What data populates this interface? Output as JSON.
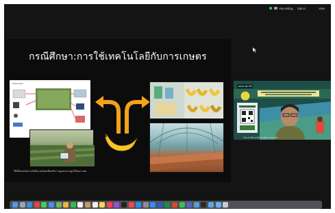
{
  "menubar": {
    "recording_label": "Recording...",
    "stop_label": "Stat in",
    "view_label": "View"
  },
  "slide": {
    "title": "กรณีศึกษา:การใช้เทคโนโลยีกับการเกษตร",
    "diagram_heading": "Smart Farm",
    "caption": "ใช้เซ็นเซอร์ตรวจวัดสิ่งแวดล้อมเพื่อปรับการดูแลเพาะปลูกให้เหมาะสม"
  },
  "video": {
    "presenter_name": "ผศ.ดร.สุภาวดี",
    "banner_text": "มหาวิทยาลัยราชภัฏ",
    "caption": "โครงการพัฒนาศักยภาพด้านการเกษตร"
  },
  "colors": {
    "arrow": "#f2a21b",
    "banana": "#f6c626",
    "video_bg": "#1f4d48",
    "recording_dot": "#3ec45a"
  },
  "dock": {
    "icons": [
      {
        "name": "finder-icon",
        "color": "#4a9be8"
      },
      {
        "name": "launchpad-icon",
        "color": "#9aa4b1"
      },
      {
        "name": "safari-icon",
        "color": "#3a8de0"
      },
      {
        "name": "chrome-icon",
        "color": "#e2453c"
      },
      {
        "name": "messages-icon",
        "color": "#3fcf5a"
      },
      {
        "name": "mail-icon",
        "color": "#4a8ef0"
      },
      {
        "name": "maps-icon",
        "color": "#66b86a"
      },
      {
        "name": "photos-icon",
        "color": "#f0b33c"
      },
      {
        "name": "facetime-icon",
        "color": "#2fbf4a"
      },
      {
        "name": "calendar-icon",
        "color": "#f4f4f4"
      },
      {
        "name": "contacts-icon",
        "color": "#c79a64"
      },
      {
        "name": "reminders-icon",
        "color": "#efefef"
      },
      {
        "name": "notes-icon",
        "color": "#f5d54a"
      },
      {
        "name": "music-icon",
        "color": "#fa3f5c"
      },
      {
        "name": "podcasts-icon",
        "color": "#9a4ad8"
      },
      {
        "name": "tv-icon",
        "color": "#222222"
      },
      {
        "name": "news-icon",
        "color": "#f14a4a"
      },
      {
        "name": "appstore-icon",
        "color": "#2d8cf0"
      },
      {
        "name": "settings-icon",
        "color": "#8c8c92"
      },
      {
        "name": "zoom-icon",
        "color": "#2d8cff"
      },
      {
        "name": "word-icon",
        "color": "#2b5fb8"
      },
      {
        "name": "excel-icon",
        "color": "#1f8a4c"
      },
      {
        "name": "powerpoint-icon",
        "color": "#d24a26"
      },
      {
        "name": "line-icon",
        "color": "#38c34a"
      },
      {
        "name": "teams-icon",
        "color": "#5b5fc7"
      },
      {
        "name": "preview-icon",
        "color": "#5a9ad8"
      },
      {
        "name": "terminal-icon",
        "color": "#2a2a2a"
      },
      {
        "name": "folder-icon",
        "color": "#5aa7e8"
      },
      {
        "name": "downloads-icon",
        "color": "#6ab0ee"
      },
      {
        "name": "trash-icon",
        "color": "#c8ccd2"
      }
    ]
  }
}
